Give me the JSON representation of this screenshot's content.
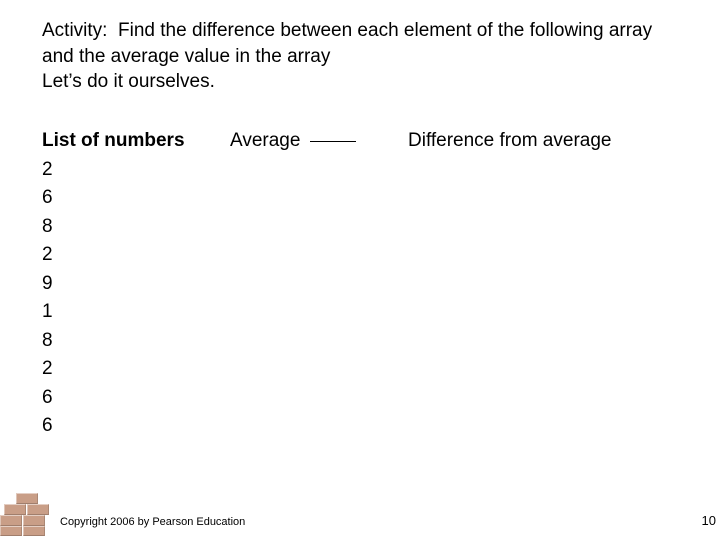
{
  "activity": {
    "label": "Activity:",
    "description": "Find the difference between each element of the following array and the average value in the array",
    "lets_do": "Let’s do it ourselves."
  },
  "columns": {
    "list_header": "List of numbers",
    "average_header": "Average",
    "diff_header": "Difference from average"
  },
  "numbers": [
    "2",
    "6",
    "8",
    "2",
    "9",
    "1",
    "8",
    "2",
    "6",
    "6"
  ],
  "footer": {
    "copyright": "Copyright 2006 by Pearson Education",
    "page": "10"
  }
}
